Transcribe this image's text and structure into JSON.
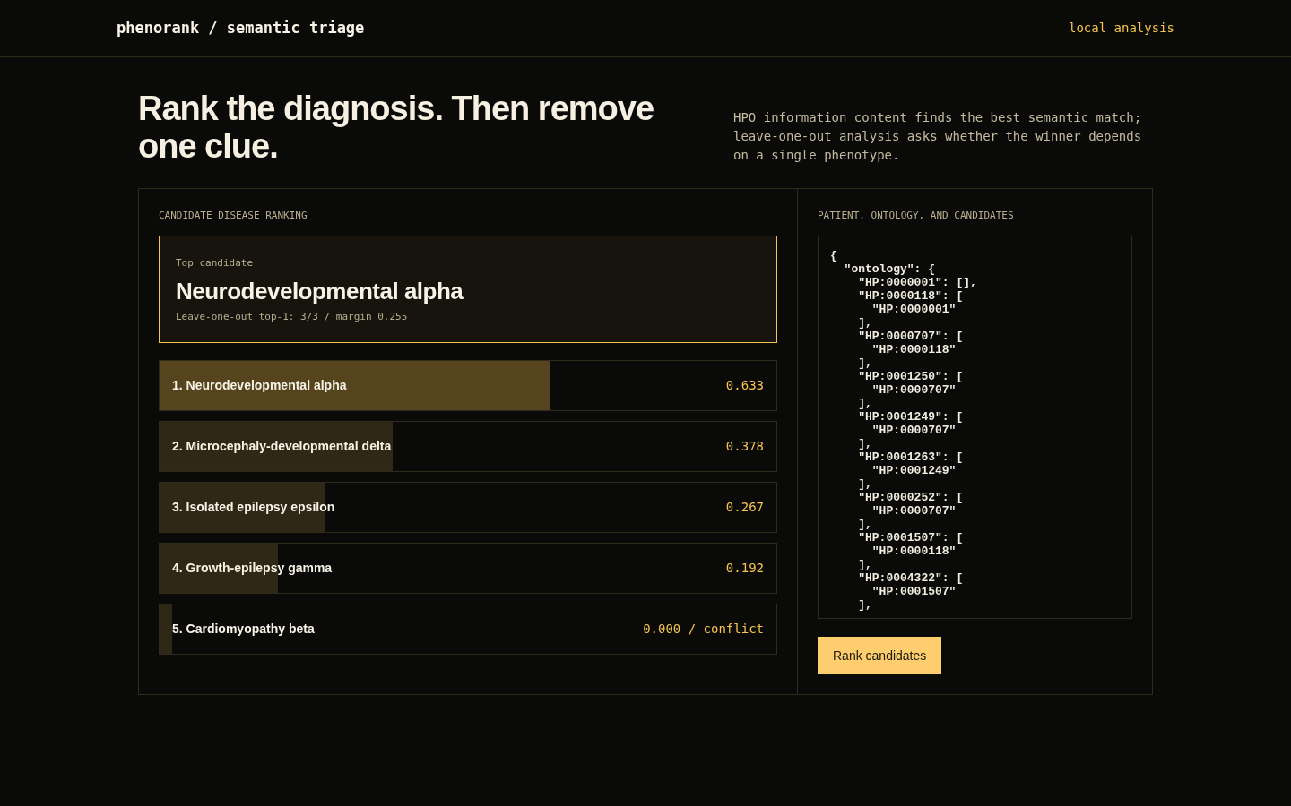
{
  "header": {
    "brand": "phenorank / semantic triage",
    "mode": "local analysis"
  },
  "hero": {
    "title": "Rank the diagnosis. Then remove one clue.",
    "description": "HPO information content finds the best semantic match; leave-one-out analysis asks whether the winner depends on a single phenotype."
  },
  "ranking": {
    "heading": "CANDIDATE DISEASE RANKING",
    "top_candidate": {
      "label": "Top candidate",
      "name": "Neurodevelopmental alpha",
      "summary": "Leave-one-out top-1: 3/3 / margin 0.255"
    },
    "candidates": [
      {
        "label": "1. Neurodevelopmental alpha",
        "score": "0.633",
        "level": 0.633,
        "highlighted": true
      },
      {
        "label": "2. Microcephaly-developmental delta",
        "score": "0.378",
        "level": 0.378,
        "highlighted": false
      },
      {
        "label": "3. Isolated epilepsy epsilon",
        "score": "0.267",
        "level": 0.267,
        "highlighted": false
      },
      {
        "label": "4. Growth-epilepsy gamma",
        "score": "0.192",
        "level": 0.192,
        "highlighted": false
      },
      {
        "label": "5. Cardiomyopathy beta",
        "score": "0.000 / conflict",
        "level": 0.02,
        "highlighted": false
      }
    ]
  },
  "input": {
    "heading": "PATIENT, ONTOLOGY, AND CANDIDATES",
    "value": "{\n  \"ontology\": {\n    \"HP:0000001\": [],\n    \"HP:0000118\": [\n      \"HP:0000001\"\n    ],\n    \"HP:0000707\": [\n      \"HP:0000118\"\n    ],\n    \"HP:0001250\": [\n      \"HP:0000707\"\n    ],\n    \"HP:0001249\": [\n      \"HP:0000707\"\n    ],\n    \"HP:0001263\": [\n      \"HP:0001249\"\n    ],\n    \"HP:0000252\": [\n      \"HP:0000707\"\n    ],\n    \"HP:0001507\": [\n      \"HP:0000118\"\n    ],\n    \"HP:0004322\": [\n      \"HP:0001507\"\n    ],",
    "button": "Rank candidates"
  }
}
